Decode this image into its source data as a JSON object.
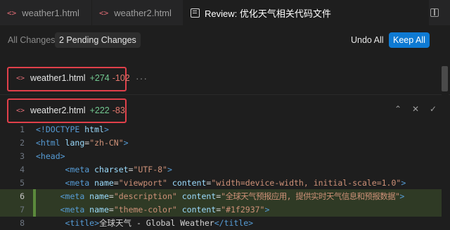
{
  "tabs": [
    {
      "icon": "code-icon",
      "label": "weather1.html"
    },
    {
      "icon": "code-icon",
      "label": "weather2.html"
    },
    {
      "icon": "review-icon",
      "label": "Review: 优化天气相关代码文件",
      "active": true
    }
  ],
  "toolbar": {
    "all_changes": "All Changes",
    "pending": "2 Pending Changes",
    "undo_all": "Undo All",
    "keep_all": "Keep All",
    "accent_color": "#0e7ad3"
  },
  "files": [
    {
      "name": "weather1.html",
      "added": "+274",
      "removed": "-102",
      "more": "···"
    },
    {
      "name": "weather2.html",
      "added": "+222",
      "removed": "-83"
    }
  ],
  "file_actions": [
    "chevron-updown-icon",
    "close-icon",
    "check-icon"
  ],
  "code_lines": [
    {
      "n": "1",
      "added": false
    },
    {
      "n": "2",
      "added": false
    },
    {
      "n": "3",
      "added": false
    },
    {
      "n": "4",
      "added": false
    },
    {
      "n": "5",
      "added": false
    },
    {
      "n": "6",
      "added": true
    },
    {
      "n": "7",
      "added": true
    },
    {
      "n": "8",
      "added": false
    }
  ],
  "code": {
    "l1": {
      "a": "<!DOCTYPE ",
      "b": "html",
      "c": ">"
    },
    "l2": {
      "a": "<html ",
      "b": "lang",
      "c": "=",
      "d": "\"zh-CN\"",
      "e": ">"
    },
    "l3": {
      "a": "<head>"
    },
    "l4": {
      "a": "<meta ",
      "b": "charset",
      "c": "=",
      "d": "\"UTF-8\"",
      "e": ">"
    },
    "l5": {
      "a": "<meta ",
      "b": "name",
      "c": "=",
      "d": "\"viewport\"",
      "e": " content",
      "f": "=",
      "g": "\"width=device-width, initial-scale=1.0\"",
      "h": ">"
    },
    "l6": {
      "a": "<meta ",
      "b": "name",
      "c": "=",
      "d": "\"description\"",
      "e": " content",
      "f": "=",
      "g": "\"全球天气预报应用, 提供实时天气信息和预报数据\"",
      "h": ">"
    },
    "l7": {
      "a": "<meta ",
      "b": "name",
      "c": "=",
      "d": "\"theme-color\"",
      "e": " content",
      "f": "=",
      "g": "\"#1f2937\"",
      "h": ">"
    },
    "l8": {
      "a": "<title>",
      "b": "全球天气 - Global Weather",
      "c": "</title>"
    }
  }
}
